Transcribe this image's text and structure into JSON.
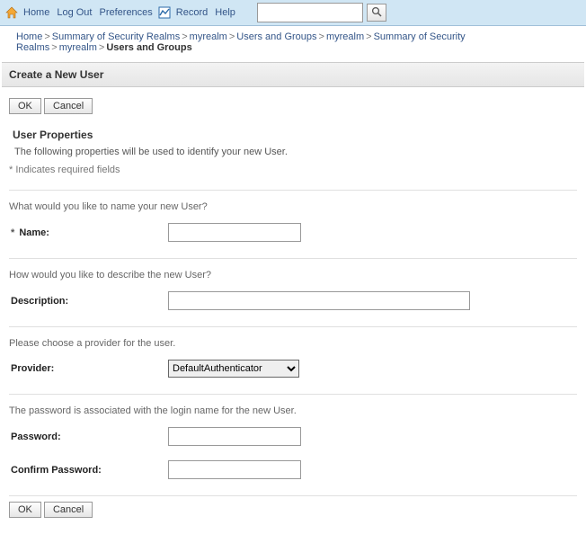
{
  "topnav": {
    "home": "Home",
    "logout": "Log Out",
    "preferences": "Preferences",
    "record": "Record",
    "help": "Help",
    "search_placeholder": ""
  },
  "breadcrumb": {
    "items": [
      "Home",
      "Summary of Security Realms",
      "myrealm",
      "Users and Groups",
      "myrealm",
      "Summary of Security Realms",
      "myrealm"
    ],
    "current": "Users and Groups"
  },
  "page": {
    "title": "Create a New User",
    "ok": "OK",
    "cancel": "Cancel",
    "section": "User Properties",
    "section_help": "The following properties will be used to identify your new User.",
    "required_note": "* Indicates required fields",
    "q_name": "What would you like to name your new User?",
    "label_name": "Name:",
    "q_desc": "How would you like to describe the new User?",
    "label_desc": "Description:",
    "q_prov": "Please choose a provider for the user.",
    "label_prov": "Provider:",
    "provider_value": "DefaultAuthenticator",
    "q_pwd": "The password is associated with the login name for the new User.",
    "label_pwd": "Password:",
    "label_cpwd": "Confirm Password:"
  }
}
